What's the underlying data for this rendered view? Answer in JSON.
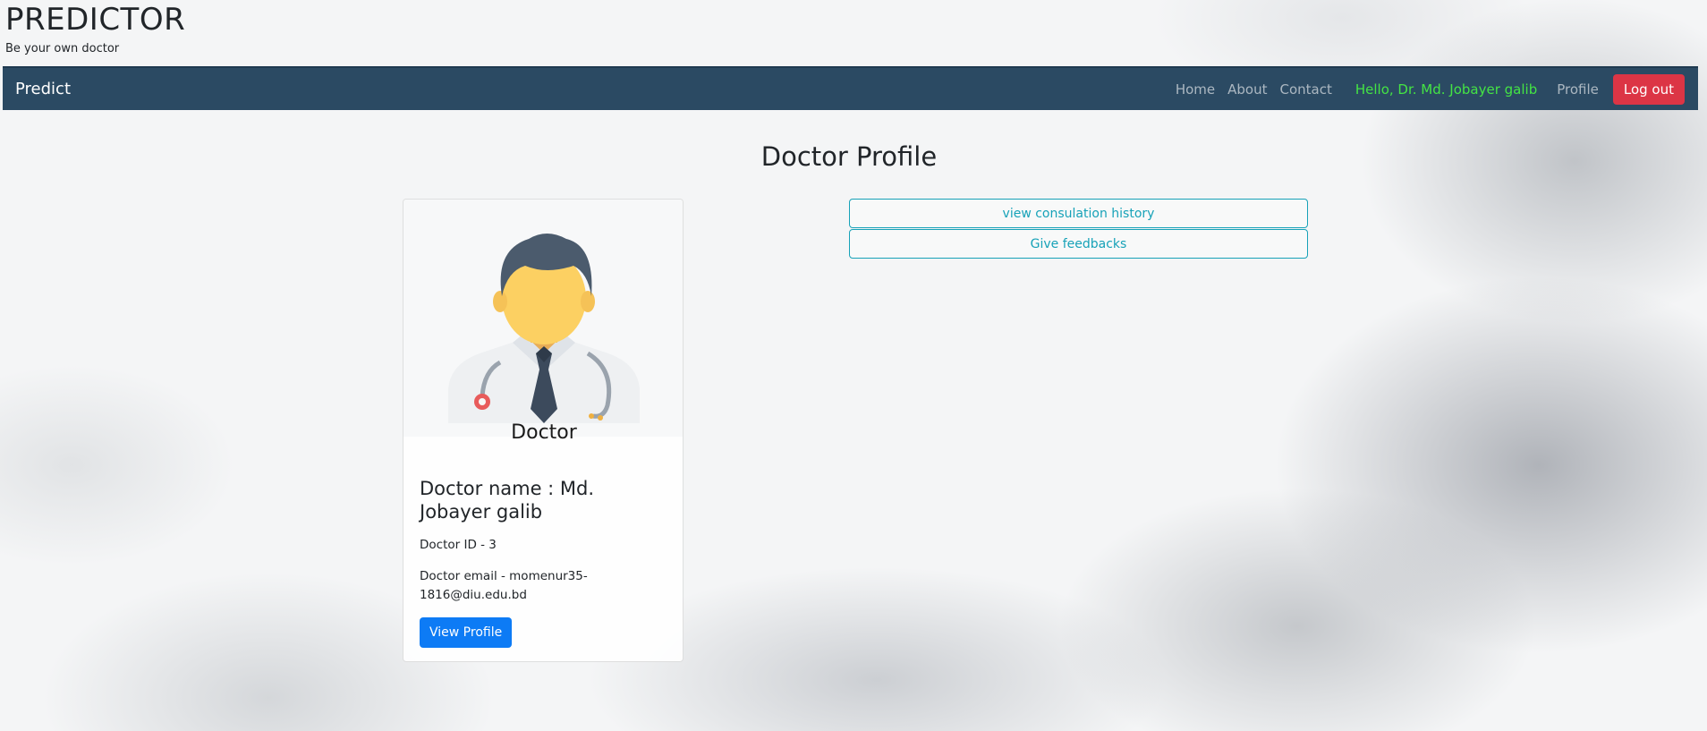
{
  "site": {
    "title": "PREDICTOR",
    "tagline": "Be your own doctor"
  },
  "navbar": {
    "brand": "Predict",
    "links": [
      {
        "label": "Home"
      },
      {
        "label": "About"
      },
      {
        "label": "Contact"
      }
    ],
    "greeting": "Hello, Dr. Md. Jobayer galib",
    "profile_label": "Profile",
    "logout_label": "Log out",
    "colors": {
      "background": "#2b4a63",
      "greeting": "#44e444",
      "logout": "#dc3545"
    }
  },
  "main": {
    "heading": "Doctor Profile",
    "card": {
      "image_icon": "doctor-avatar-icon",
      "image_caption": "Doctor",
      "name_line": "Doctor name : Md. Jobayer galib",
      "id_line": "Doctor ID - 3",
      "email_line": "Doctor email - momenur35-1816@diu.edu.bd",
      "button_label": "View Profile"
    },
    "actions": [
      {
        "label": "view consulation history"
      },
      {
        "label": "Give feedbacks"
      }
    ],
    "colors": {
      "primary": "#0d7bf5",
      "info": "#17a2b8"
    }
  }
}
